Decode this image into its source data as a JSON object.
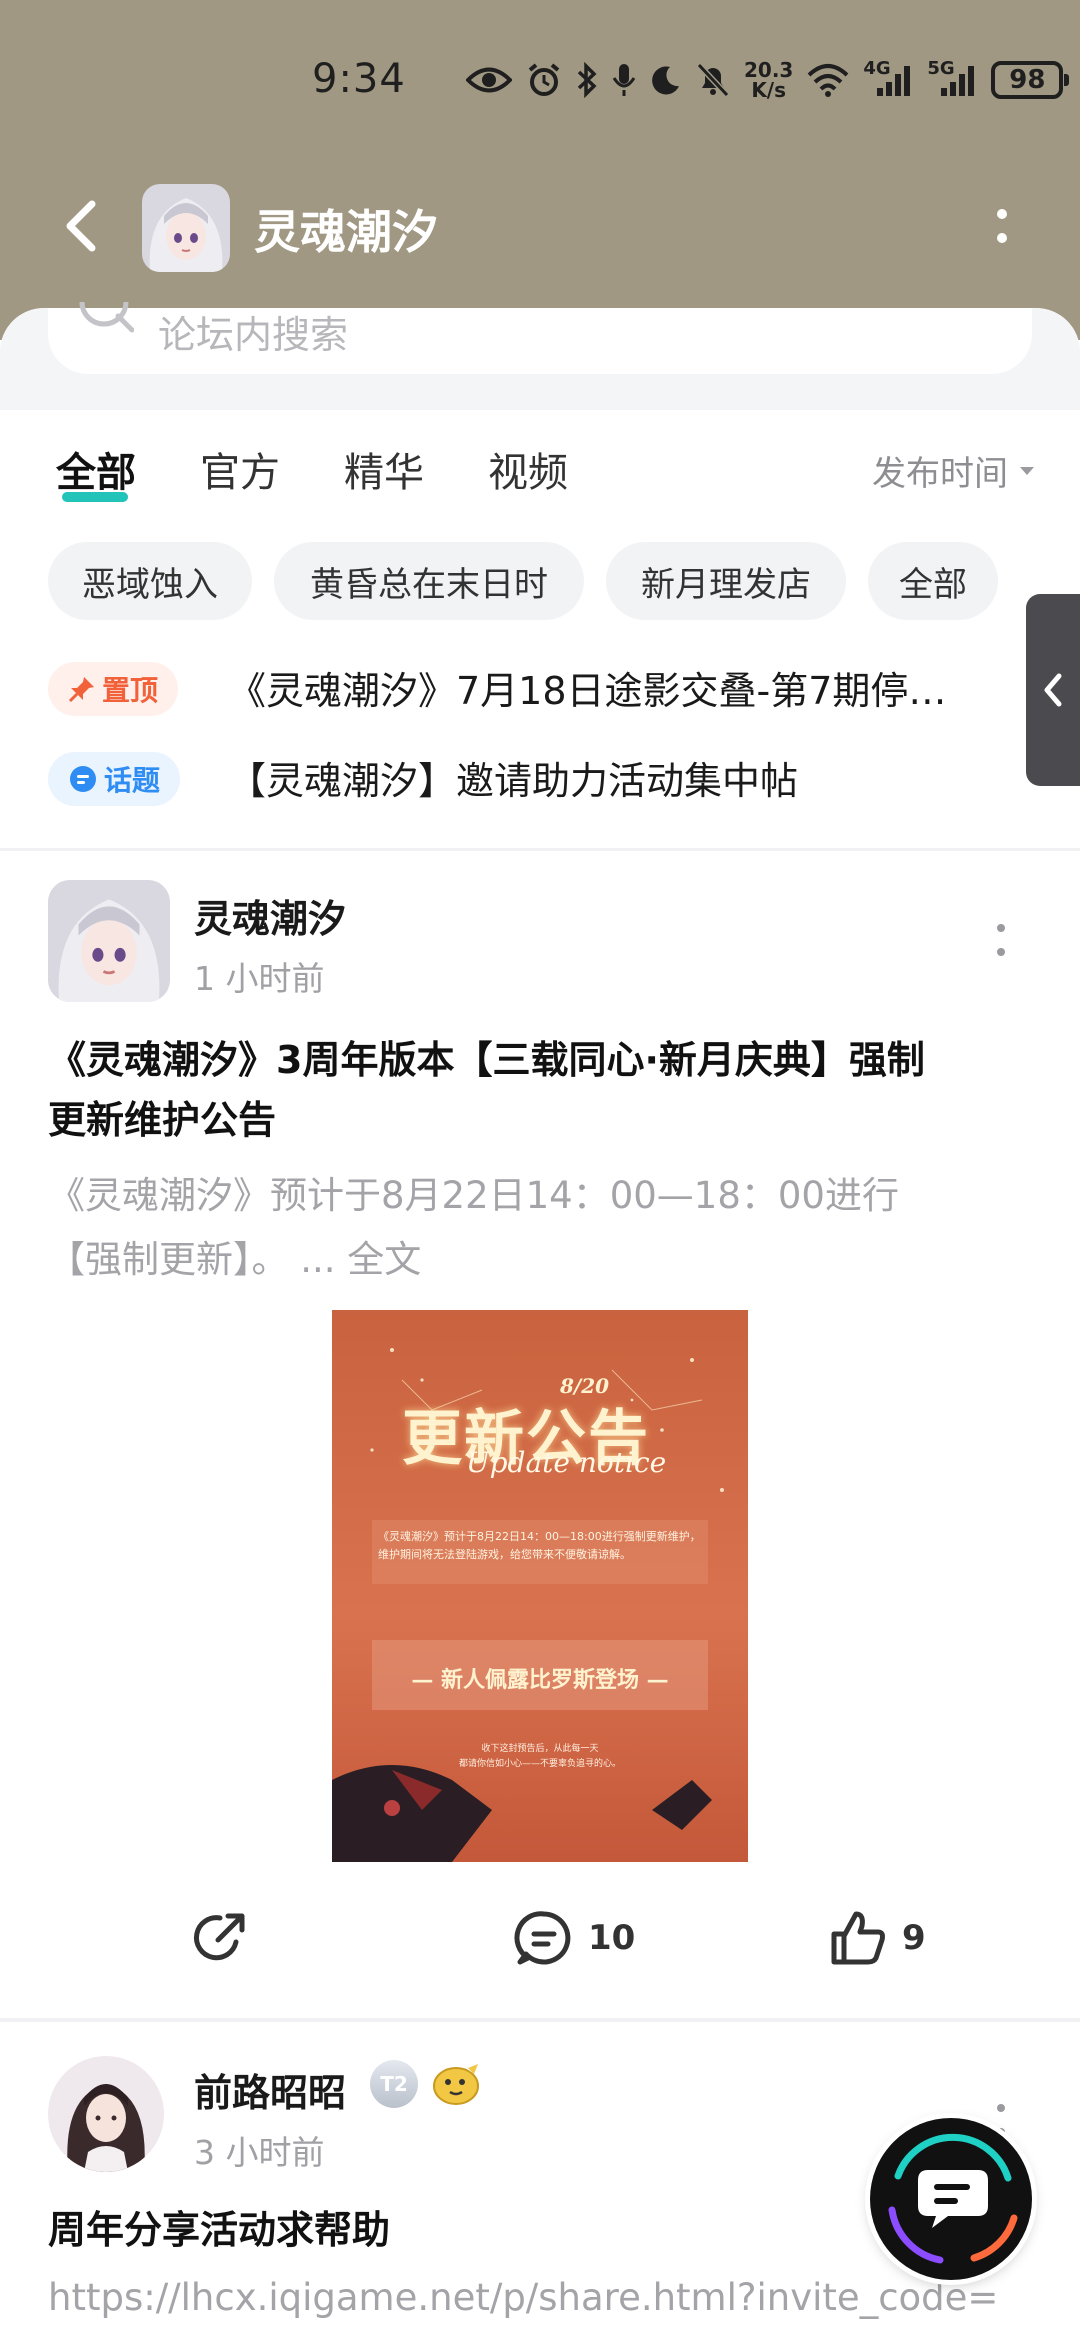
{
  "status_bar": {
    "time": "9:34",
    "net_speed_value": "20.3",
    "net_speed_unit": "K/s",
    "net1": "4G",
    "net2": "5G",
    "battery": "98"
  },
  "nav": {
    "title": "灵魂潮汐"
  },
  "search": {
    "placeholder": "论坛内搜索"
  },
  "tabs": [
    {
      "label": "全部",
      "active": true
    },
    {
      "label": "官方",
      "active": false
    },
    {
      "label": "精华",
      "active": false
    },
    {
      "label": "视频",
      "active": false
    }
  ],
  "sort": {
    "label": "发布时间"
  },
  "chips": [
    "恶域蚀入",
    "黄昏总在末日时",
    "新月理发店",
    "全部"
  ],
  "notices": [
    {
      "badge": "置顶",
      "text": "《灵魂潮汐》7月18日途影交叠-第7期停…"
    },
    {
      "badge": "话题",
      "text": "【灵魂潮汐】邀请助力活动集中帖"
    }
  ],
  "post1": {
    "author": "灵魂潮汐",
    "time": "1 小时前",
    "title_line1": "《灵魂潮汐》3周年版本【三载同心·新月庆典】强制",
    "title_line2": "更新维护公告",
    "summary_line1": "《灵魂潮汐》预计于8月22日14：00—18：00进行",
    "summary_line2": "【强制更新】。",
    "more_text": "... 全文",
    "image": {
      "date": "8/20",
      "title": "更新公告",
      "subtitle": "Update notice",
      "body": "《灵魂潮汐》预计于8月22日14：00—18:00进行强制更新维护，维护期间将无法登陆游戏，给您带来不便敬请谅解。",
      "banner": "— 新人佩露比罗斯登场 —",
      "caption_line1": "收下这封预告后，从此每一天",
      "caption_line2": "都请你信如小心——不要辜负追寻的心。"
    },
    "comments": "10",
    "likes": "9"
  },
  "post2": {
    "author": "前路昭昭",
    "level": "T2",
    "time": "3 小时前",
    "title": "周年分享活动求帮助",
    "link": "https://lhcx.iqigame.net/p/share.html?invite_code="
  },
  "colors": {
    "header_bg": "#a09883",
    "accent": "#22c3b8",
    "pin": "#f2623a",
    "topic": "#2f8cf3"
  }
}
